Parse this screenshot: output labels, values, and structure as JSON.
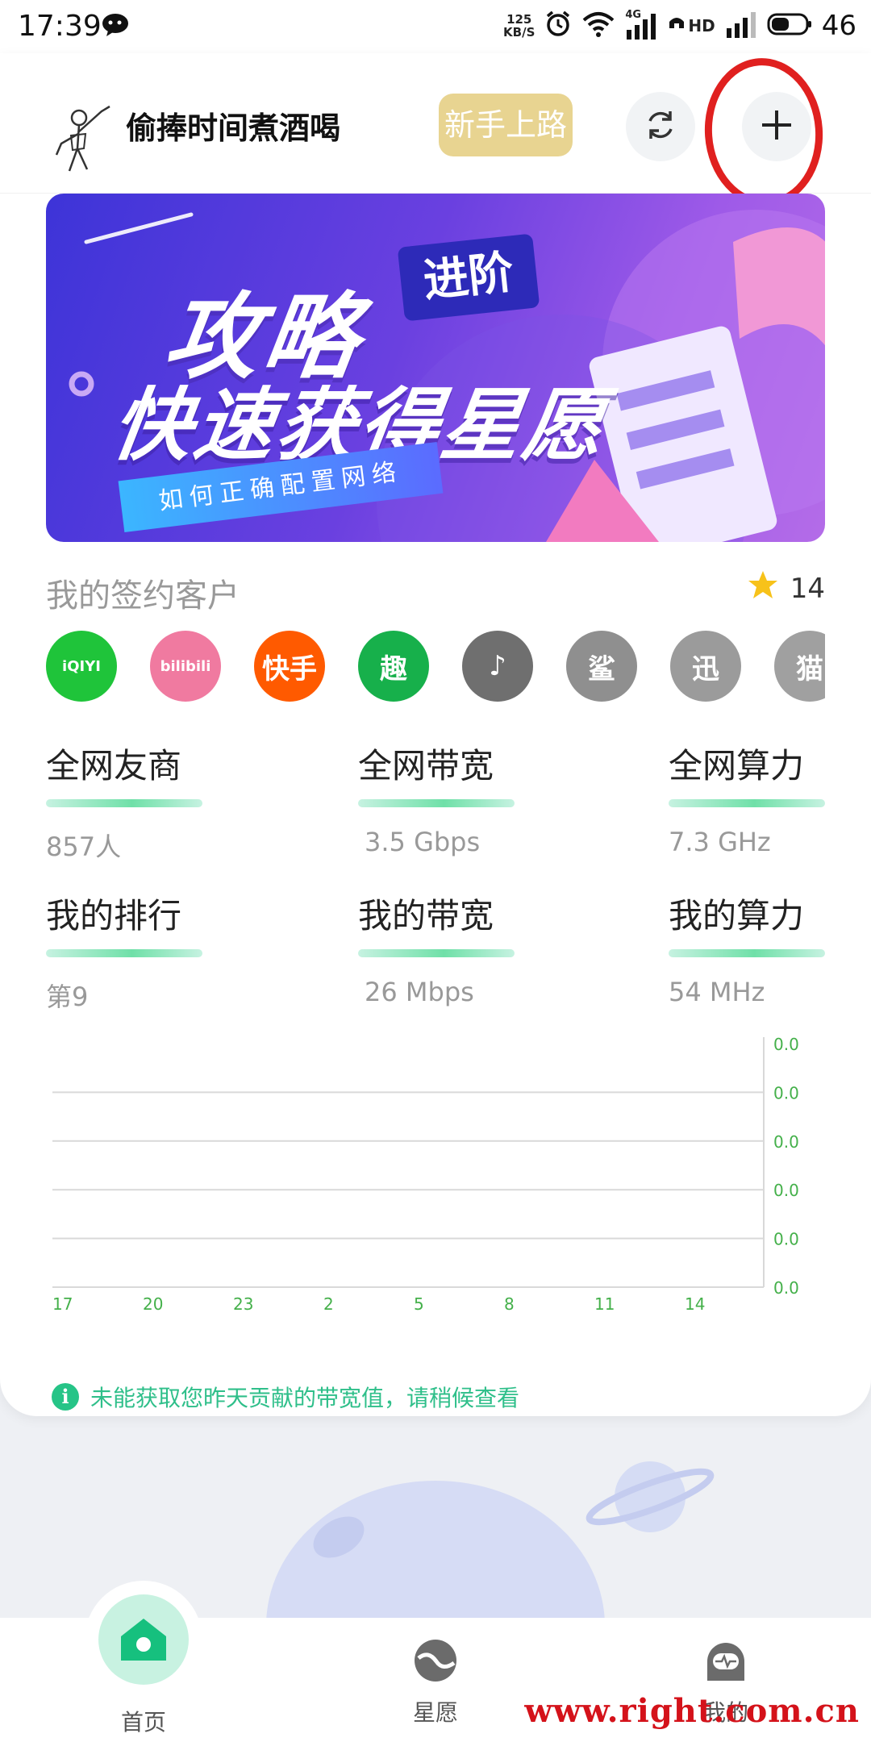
{
  "status_bar": {
    "time": "17:39",
    "speed_value": "125",
    "speed_unit": "KB/S",
    "network": "4G",
    "hd": "HD",
    "battery": "46"
  },
  "header": {
    "username": "偷捧时间煮酒喝",
    "newbie_label": "新手上路"
  },
  "banner": {
    "title": "攻略",
    "tag": "进阶",
    "subtitle": "快速获得星愿",
    "strip": "如何正确配置网络"
  },
  "clients": {
    "title": "我的签约客户",
    "count": "14",
    "logos": [
      {
        "name": "iqiyi",
        "text": "iQIYI",
        "color": "#1fc43a"
      },
      {
        "name": "bilibili",
        "text": "bilibili",
        "color": "#f07aa0"
      },
      {
        "name": "kuaishou",
        "text": "快手",
        "color": "#ff5a00"
      },
      {
        "name": "quhuo",
        "text": "趣",
        "color": "#17b04b"
      },
      {
        "name": "douyin",
        "text": "♪",
        "color": "#6f6f6f"
      },
      {
        "name": "shark",
        "text": "鲨",
        "color": "#8f8f8f"
      },
      {
        "name": "xunlei",
        "text": "迅",
        "color": "#9b9b9b"
      },
      {
        "name": "cat",
        "text": "猫",
        "color": "#a0a0a0"
      }
    ]
  },
  "stats": [
    {
      "title": "全网友商",
      "value": "857人"
    },
    {
      "title": "全网带宽",
      "value": "3.5 Gbps"
    },
    {
      "title": "全网算力",
      "value": "7.3 GHz"
    },
    {
      "title": "我的排行",
      "value": "第9"
    },
    {
      "title": "我的带宽",
      "value": "26 Mbps"
    },
    {
      "title": "我的算力",
      "value": "54 MHz"
    }
  ],
  "chart_data": {
    "type": "line",
    "categories": [
      "17",
      "20",
      "23",
      "2",
      "5",
      "8",
      "11",
      "14"
    ],
    "y_tick_labels": [
      "0.0",
      "0.0",
      "0.0",
      "0.0",
      "0.0",
      "0.0"
    ],
    "series": [],
    "axis_color": "#44b04a",
    "grid": true
  },
  "chart_note": "未能获取您昨天贡献的带宽值，请稍候查看",
  "nav": {
    "home": "首页",
    "wish": "星愿",
    "mine": "我的"
  },
  "watermark": "www.right.com.cn"
}
